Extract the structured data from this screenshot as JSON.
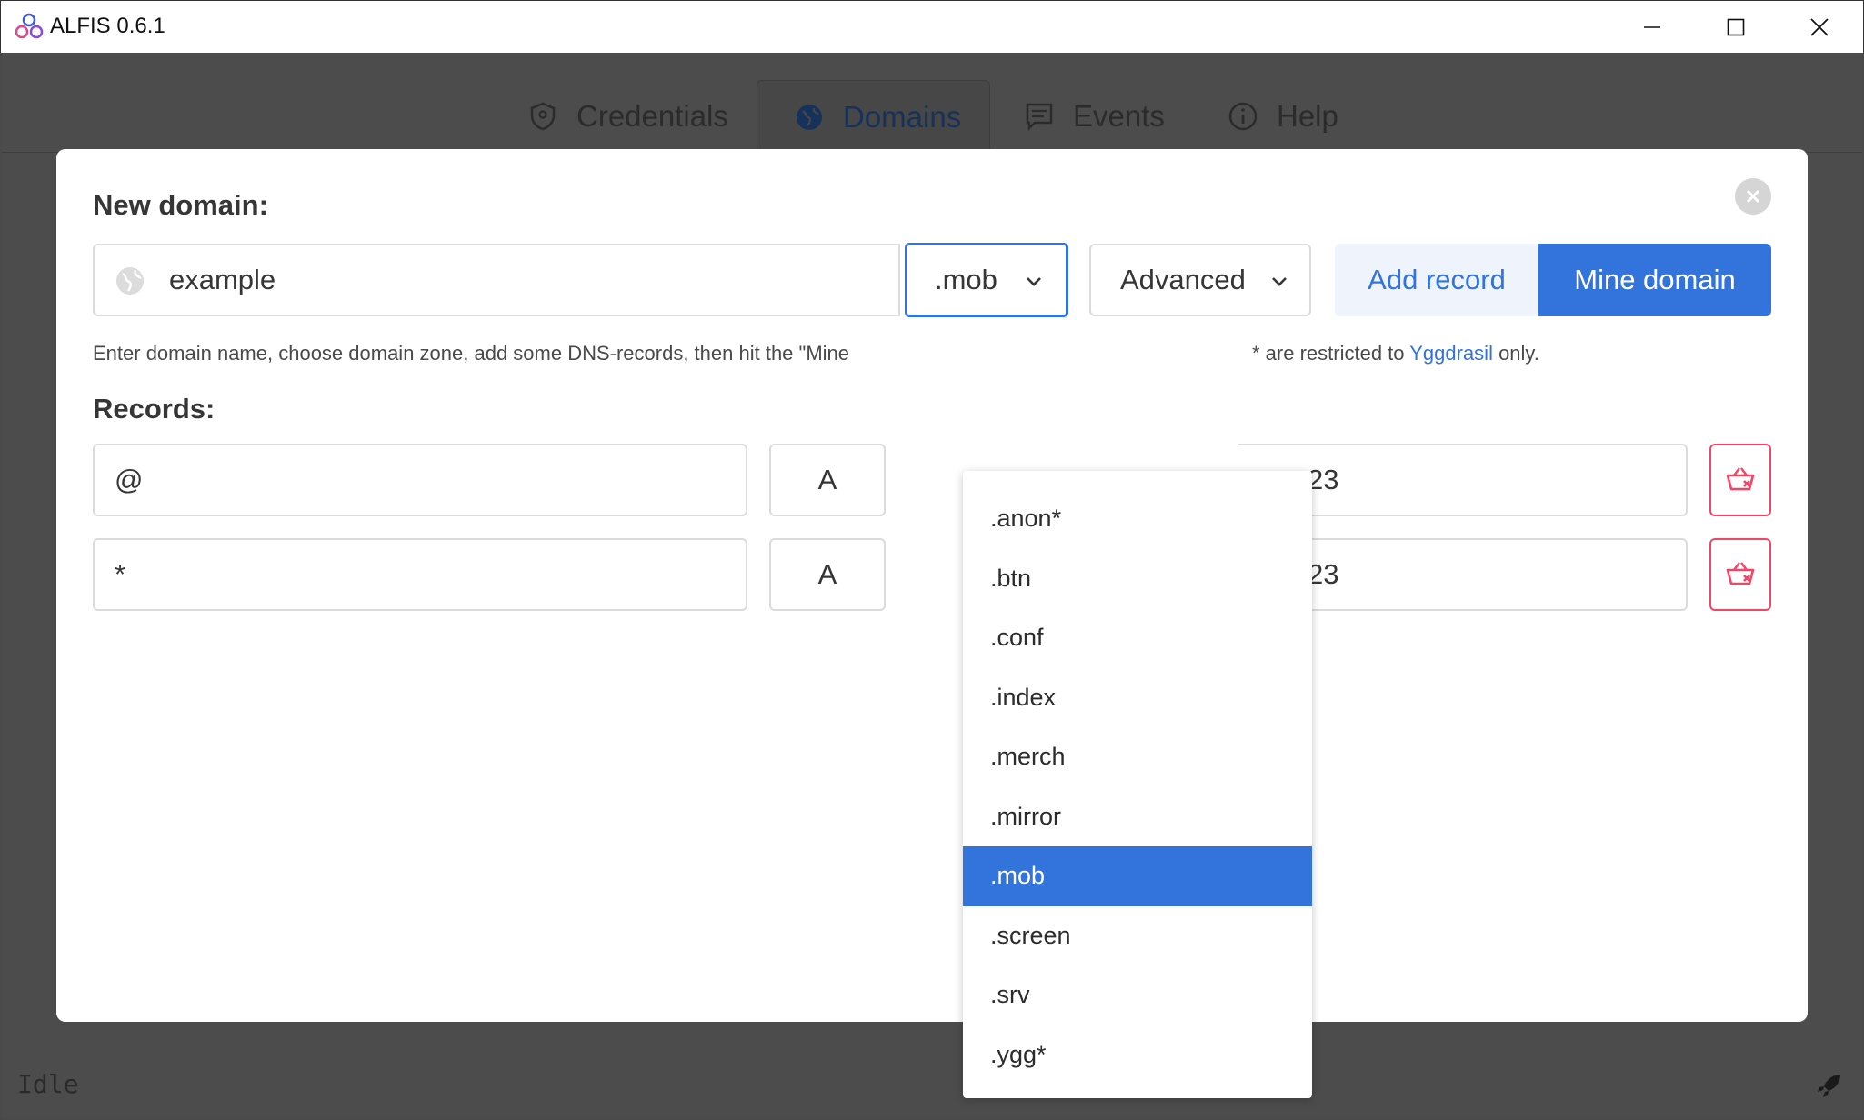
{
  "window": {
    "title": "ALFIS 0.6.1"
  },
  "tabs": [
    {
      "label": "Credentials",
      "icon": "shield-icon"
    },
    {
      "label": "Domains",
      "icon": "globe-icon"
    },
    {
      "label": "Events",
      "icon": "chat-icon"
    },
    {
      "label": "Help",
      "icon": "info-icon"
    }
  ],
  "status": {
    "text": "Idle"
  },
  "modal": {
    "title": "New domain:",
    "domain_value": "example",
    "zone_selected": ".mob",
    "advanced_label": "Advanced",
    "add_record_label": "Add record",
    "mine_domain_label": "Mine domain",
    "help_left": "Enter domain name, choose domain zone, add some DNS-records, then hit the \"Mine",
    "help_right_prefix": "* are restricted to ",
    "help_link": "Yggdrasil",
    "help_right_suffix": " only.",
    "records_title": "Records:",
    "records": [
      {
        "name": "@",
        "type": "A",
        "data_visible": "23"
      },
      {
        "name": "*",
        "type": "A",
        "data_visible": "23"
      }
    ]
  },
  "zone_options": [
    ".anon*",
    ".btn",
    ".conf",
    ".index",
    ".merch",
    ".mirror",
    ".mob",
    ".screen",
    ".srv",
    ".ygg*"
  ],
  "colors": {
    "accent": "#3273dc",
    "danger": "#f14668",
    "overlay": "#4a4a4a"
  }
}
